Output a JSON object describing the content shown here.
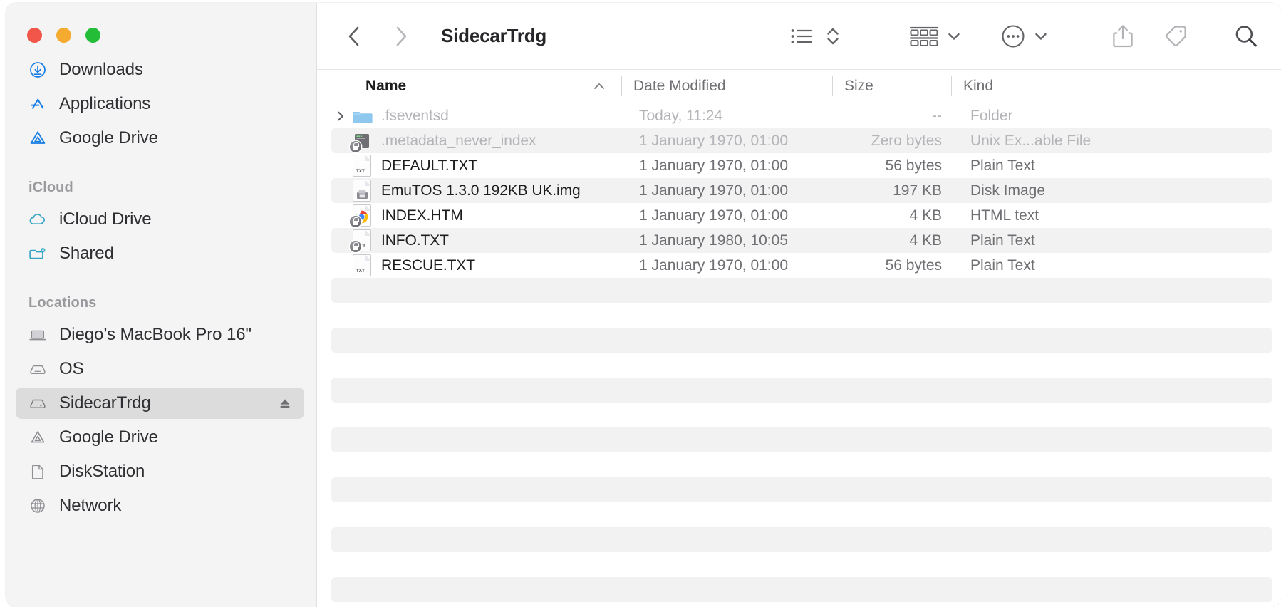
{
  "window": {
    "traffic_lights": [
      {
        "name": "close",
        "color": "#f2564a"
      },
      {
        "name": "minimize",
        "color": "#f5ab2f"
      },
      {
        "name": "maximize",
        "color": "#24bd38"
      }
    ]
  },
  "toolbar": {
    "back_label": "Back",
    "forward_label": "Forward",
    "title": "SidecarTrdg",
    "view_list_label": "List View",
    "sort_label": "Sort",
    "group_label": "Group By",
    "more_label": "More",
    "share_label": "Share",
    "tag_label": "Tags",
    "search_label": "Search"
  },
  "sidebar": {
    "sections": [
      {
        "header": "",
        "items": [
          {
            "label": "Downloads",
            "icon": "downloads-icon",
            "selected": false,
            "eject": false
          },
          {
            "label": "Applications",
            "icon": "applications-icon",
            "selected": false,
            "eject": false
          },
          {
            "label": "Google Drive",
            "icon": "google-drive-blue-icon",
            "selected": false,
            "eject": false
          }
        ]
      },
      {
        "header": "iCloud",
        "items": [
          {
            "label": "iCloud Drive",
            "icon": "cloud-icon",
            "selected": false,
            "eject": false
          },
          {
            "label": "Shared",
            "icon": "shared-folder-icon",
            "selected": false,
            "eject": false
          }
        ]
      },
      {
        "header": "Locations",
        "items": [
          {
            "label": "Diego’s MacBook Pro 16\"",
            "icon": "laptop-icon",
            "selected": false,
            "eject": false
          },
          {
            "label": "OS",
            "icon": "harddisk-icon",
            "selected": false,
            "eject": false
          },
          {
            "label": "SidecarTrdg",
            "icon": "harddisk-icon",
            "selected": true,
            "eject": true
          },
          {
            "label": "Google Drive",
            "icon": "google-drive-gray-icon",
            "selected": false,
            "eject": false
          },
          {
            "label": "DiskStation",
            "icon": "document-icon",
            "selected": false,
            "eject": false
          },
          {
            "label": "Network",
            "icon": "globe-icon",
            "selected": false,
            "eject": false
          }
        ]
      }
    ]
  },
  "file_list": {
    "columns": [
      {
        "key": "name",
        "label": "Name",
        "active": true,
        "sort": "asc"
      },
      {
        "key": "date",
        "label": "Date Modified",
        "active": false
      },
      {
        "key": "size",
        "label": "Size",
        "active": false
      },
      {
        "key": "kind",
        "label": "Kind",
        "active": false
      }
    ],
    "rows": [
      {
        "name": ".fseventsd",
        "date": "Today, 11:24",
        "size": "--",
        "kind": "Folder",
        "icon": "folder-icon",
        "dimmed": true,
        "disclosure": true,
        "alt": false
      },
      {
        "name": ".metadata_never_index",
        "date": "1 January 1970, 01:00",
        "size": "Zero bytes",
        "kind": "Unix Ex...able File",
        "icon": "unix-executable-icon",
        "dimmed": true,
        "disclosure": false,
        "alt": true
      },
      {
        "name": "DEFAULT.TXT",
        "date": "1 January 1970, 01:00",
        "size": "56 bytes",
        "kind": "Plain Text",
        "icon": "txt-file-icon",
        "dimmed": false,
        "disclosure": false,
        "alt": false
      },
      {
        "name": "EmuTOS 1.3.0 192KB UK.img",
        "date": "1 January 1970, 01:00",
        "size": "197 KB",
        "kind": "Disk Image",
        "icon": "disk-image-icon",
        "dimmed": false,
        "disclosure": false,
        "alt": true
      },
      {
        "name": "INDEX.HTM",
        "date": "1 January 1970, 01:00",
        "size": "4 KB",
        "kind": "HTML text",
        "icon": "chrome-html-icon",
        "dimmed": false,
        "disclosure": false,
        "alt": false
      },
      {
        "name": "INFO.TXT",
        "date": "1 January 1980, 10:05",
        "size": "4 KB",
        "kind": "Plain Text",
        "icon": "locked-txt-file-icon",
        "dimmed": false,
        "disclosure": false,
        "alt": true
      },
      {
        "name": "RESCUE.TXT",
        "date": "1 January 1970, 01:00",
        "size": "56 bytes",
        "kind": "Plain Text",
        "icon": "txt-file-icon",
        "dimmed": false,
        "disclosure": false,
        "alt": false
      }
    ],
    "empty_row_count": 13
  },
  "colors": {
    "selection": "#dcdcdc",
    "alt_row": "#f2f2f2",
    "sidebar_bg": "#f4f4f4",
    "accent_blue": "#147ce5",
    "icloud_teal": "#30a4c4"
  }
}
